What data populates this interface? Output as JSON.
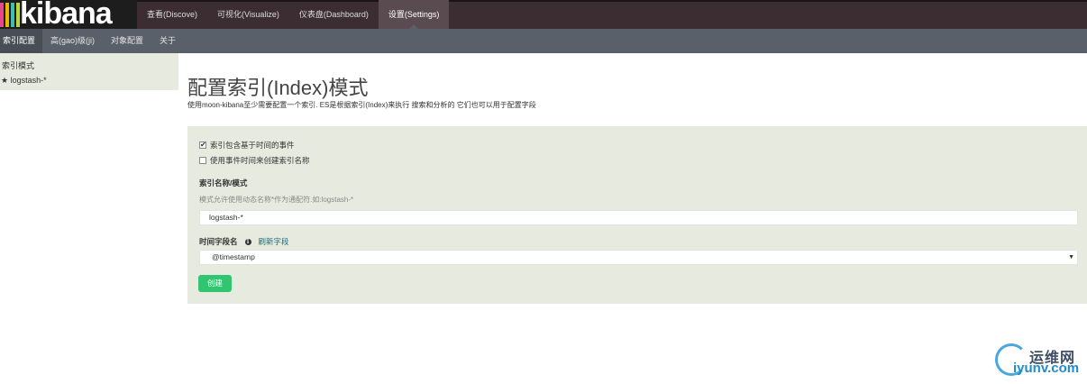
{
  "brand": {
    "logo_text": "kibana",
    "stripe_colors": [
      "#e8488b",
      "#f0b400",
      "#3ebeb0",
      "#b5d936"
    ]
  },
  "nav": {
    "items": [
      {
        "label": "查看(Discove)"
      },
      {
        "label": "可视化(Visualize)"
      },
      {
        "label": "仪表盘(Dashboard)"
      },
      {
        "label": "设置(Settings)"
      }
    ],
    "active": "设置(Settings)"
  },
  "subnav": {
    "items": [
      {
        "label": "索引配置"
      },
      {
        "label": "高(gao)级(ji)"
      },
      {
        "label": "对象配置"
      },
      {
        "label": "关于"
      }
    ]
  },
  "sidebar": {
    "title": "索引模式",
    "items": [
      {
        "label": "logstash-*"
      }
    ]
  },
  "main": {
    "title": "配置索引(Index)模式",
    "description": "使用moon-kibana至少需要配置一个索引. ES是根据索引(Index)来执行 搜索和分析的 它们也可以用于配置字段"
  },
  "form": {
    "checkbox_time_based": {
      "label": "索引包含基于时间的事件",
      "checked": true
    },
    "checkbox_event_time": {
      "label": "使用事件时间来创建索引名称",
      "checked": false
    },
    "index_name_label": "索引名称/模式",
    "index_name_hint": "模式允许使用动态名称*作为通配符.如:logstash-*",
    "index_name_value": "logstash-*",
    "time_field_label": "时间字段名",
    "refresh_fields": "刷新字段",
    "time_field_value": "@timestamp",
    "create_button": "创建"
  },
  "watermark": {
    "cn": "运维网",
    "en": "iyunv.com"
  },
  "icons": {
    "star": "★",
    "check": "✔",
    "info": "i",
    "dropdown": "▼"
  }
}
